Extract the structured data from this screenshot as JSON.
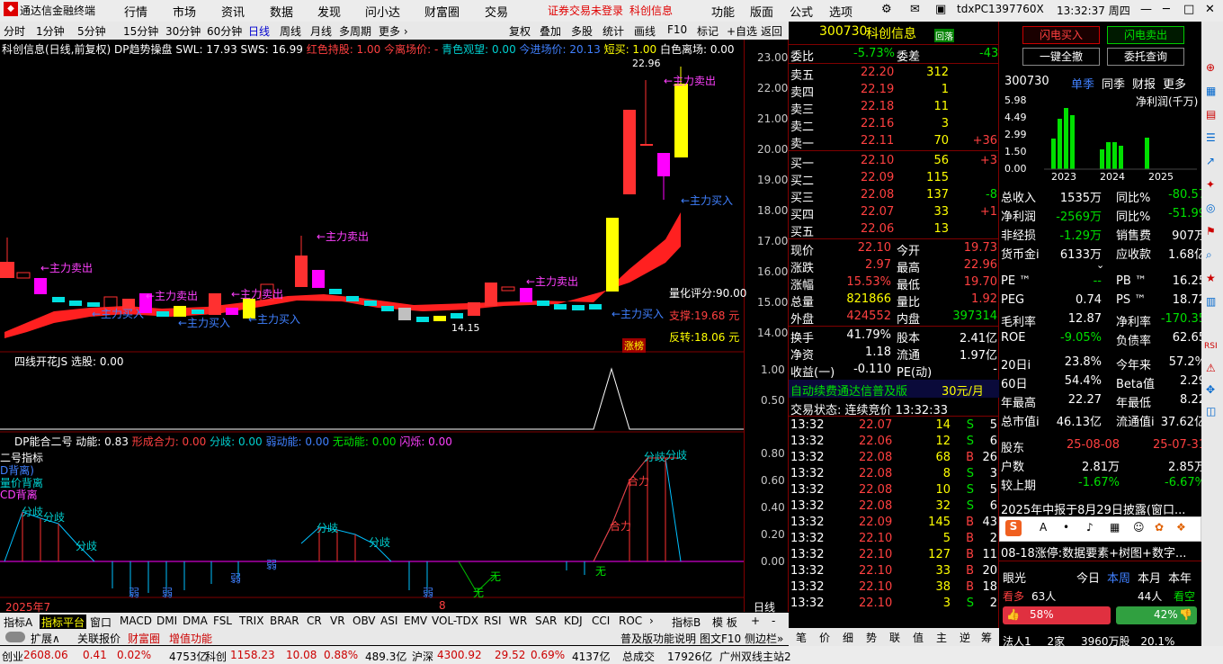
{
  "menubar": {
    "logo": "通达信金融终端",
    "items": [
      "行情",
      "市场",
      "资讯",
      "数据",
      "发现",
      "问小达",
      "财富圈",
      "交易"
    ],
    "warn": "证券交易未登录",
    "stock": "科创信息",
    "right": [
      "功能",
      "版面",
      "公式",
      "选项"
    ],
    "user": "tdxPC1397760X",
    "time": "13:32:37 周四"
  },
  "periods": [
    "分时",
    "1分钟",
    "5分钟",
    "15分钟",
    "30分钟",
    "60分钟",
    "日线",
    "周线",
    "月线",
    "多周期",
    "更多 ›"
  ],
  "tools": [
    "复权",
    "叠加",
    "多股",
    "统计",
    "画线",
    "F10",
    "标记",
    "+自选",
    "返回"
  ],
  "main_title": {
    "name": "科创信息(日线,前复权)",
    "indicator": "DP趋势操盘",
    "swl": "SWL: 17.93",
    "sws": "SWS: 16.99",
    "hold": "红色持股: 1.00",
    "leave": "今离场价: -",
    "observe": "青色观望: 0.00",
    "enter": "今进场价: 20.13",
    "short": "短买: 1.00",
    "white": "白色离场: 0.00"
  },
  "price_axis": [
    "23.00",
    "22.00",
    "21.00",
    "20.00",
    "19.00",
    "18.00",
    "17.00",
    "16.00",
    "15.00",
    "14.00"
  ],
  "annotations": {
    "high": "22.96",
    "low": "14.15",
    "main_sell": "←主力卖出",
    "main_buy": "←主力买入",
    "score": "量化评分:90.00",
    "support": "支撑:19.68 元",
    "reverse": "反转:18.06 元",
    "zt": "涨榜"
  },
  "panel2": {
    "title": "四线开花JS 选股: 0.00",
    "axis": [
      "1.00",
      "0.50"
    ]
  },
  "panel3": {
    "title": "DP能合二号 动能: 0.83",
    "xing": "形成合力: 0.00",
    "fen": "分歧: 0.00",
    "ruo": "弱动能: 0.00",
    "wu": "无动能: 0.00",
    "shan": "闪烁: 0.00",
    "axis": [
      "0.80",
      "0.60",
      "0.40",
      "0.20",
      "0.00"
    ],
    "legend": [
      "二号指标",
      "D背离)",
      "量价背离",
      "CD背离"
    ],
    "fenqi": "分歧",
    "heli": "合力",
    "wu_lbl": "无",
    "ruo_lbl": "弱"
  },
  "dates": {
    "d1": "2025年7",
    "d2": "8",
    "period": "日线"
  },
  "bottom_tabs": [
    "指标A",
    "指标平台",
    "窗口",
    "MACD",
    "DMI",
    "DMA",
    "FSL",
    "TRIX",
    "BRAR",
    "CR",
    "VR",
    "OBV",
    "ASI",
    "EMV",
    "VOL-TDX",
    "RSI",
    "WR",
    "SAR",
    "KDJ",
    "CCI",
    "ROC",
    "›",
    "指标B",
    "模 板",
    "+",
    "-"
  ],
  "sub_tabs": [
    "扩展∧",
    "关联报价",
    "财富圈",
    "增值功能",
    "普及版功能说明",
    "图文F10",
    "侧边栏»"
  ],
  "quote": {
    "code": "300730",
    "name": "科创信息",
    "tag": "回落",
    "weibi_l": "委比",
    "weibi": "-5.73%",
    "weicha_l": "委差",
    "weicha": "-43",
    "sells": [
      {
        "l": "卖五",
        "p": "22.20",
        "v": "312",
        "c": ""
      },
      {
        "l": "卖四",
        "p": "22.19",
        "v": "1",
        "c": ""
      },
      {
        "l": "卖三",
        "p": "22.18",
        "v": "11",
        "c": ""
      },
      {
        "l": "卖二",
        "p": "22.16",
        "v": "3",
        "c": ""
      },
      {
        "l": "卖一",
        "p": "22.11",
        "v": "70",
        "c": "+36"
      }
    ],
    "buys": [
      {
        "l": "买一",
        "p": "22.10",
        "v": "56",
        "c": "+3"
      },
      {
        "l": "买二",
        "p": "22.09",
        "v": "115",
        "c": ""
      },
      {
        "l": "买三",
        "p": "22.08",
        "v": "137",
        "c": "-8"
      },
      {
        "l": "买四",
        "p": "22.07",
        "v": "33",
        "c": "+1"
      },
      {
        "l": "买五",
        "p": "22.06",
        "v": "13",
        "c": ""
      }
    ],
    "stats": [
      [
        "现价",
        "22.10",
        "今开",
        "19.73"
      ],
      [
        "涨跌",
        "2.97",
        "最高",
        "22.96"
      ],
      [
        "涨幅",
        "15.53%",
        "最低",
        "19.70"
      ],
      [
        "总量",
        "821866",
        "量比",
        "1.92"
      ],
      [
        "外盘",
        "424552",
        "内盘",
        "397314"
      ]
    ],
    "stats2": [
      [
        "换手",
        "41.79%",
        "股本",
        "2.41亿"
      ],
      [
        "净资",
        "1.18",
        "流通",
        "1.97亿"
      ],
      [
        "收益(一)",
        "-0.110",
        "PE(动)",
        "-"
      ]
    ],
    "ad": "自动续费通达信普及版",
    "ad_price": "30元/月",
    "state": "交易状态: 连续竞价 13:32:33",
    "ticks": [
      [
        "13:32",
        "22.07",
        "14",
        "S",
        "5"
      ],
      [
        "13:32",
        "22.06",
        "12",
        "S",
        "6"
      ],
      [
        "13:32",
        "22.08",
        "68",
        "B",
        "26"
      ],
      [
        "13:32",
        "22.08",
        "8",
        "S",
        "3"
      ],
      [
        "13:32",
        "22.08",
        "10",
        "S",
        "5"
      ],
      [
        "13:32",
        "22.08",
        "32",
        "S",
        "6"
      ],
      [
        "13:32",
        "22.09",
        "145",
        "B",
        "43"
      ],
      [
        "13:32",
        "22.10",
        "5",
        "B",
        "2"
      ],
      [
        "13:32",
        "22.10",
        "127",
        "B",
        "11"
      ],
      [
        "13:32",
        "22.10",
        "33",
        "B",
        "20"
      ],
      [
        "13:32",
        "22.10",
        "38",
        "B",
        "18"
      ],
      [
        "13:32",
        "22.10",
        "3",
        "S",
        "2"
      ]
    ],
    "bottom": [
      "笔",
      "价",
      "细",
      "势",
      "联",
      "值",
      "主",
      "逆",
      "筹"
    ]
  },
  "info": {
    "btn_buy": "闪电买入",
    "btn_sell": "闪电卖出",
    "btn_clear": "一键全撤",
    "btn_query": "委托查询",
    "code": "300730",
    "tabs": [
      "单季",
      "同季",
      "财报",
      "更多"
    ],
    "profit_lbl": "净利润(千万)",
    "y_axis": [
      "5.98",
      "4.49",
      "2.99",
      "1.50",
      "0.00"
    ],
    "years": [
      "2023",
      "2024",
      "2025"
    ],
    "fin": [
      [
        "总收入",
        "1535万",
        "同比%",
        "-80.57"
      ],
      [
        "净利润",
        "-2569万",
        "同比%",
        "-51.99"
      ],
      [
        "非经损",
        "-1.29万",
        "销售费",
        "907万"
      ],
      [
        "货币金i",
        "6133万",
        "应收款",
        "1.68亿"
      ]
    ],
    "fin2": [
      [
        "PE ™",
        "--",
        "PB ™",
        "16.25"
      ],
      [
        "PEG",
        "0.74",
        "PS ™",
        "18.72"
      ],
      [
        "毛利率",
        "12.87",
        "净利率",
        "-170.35"
      ],
      [
        "ROE",
        "-9.05%",
        "负债率",
        "62.65"
      ]
    ],
    "fin3": [
      [
        "20日i",
        "23.8%",
        "今年来",
        "57.2%"
      ],
      [
        "60日",
        "54.4%",
        "Beta值",
        "2.29"
      ],
      [
        "年最高",
        "22.27",
        "年最低",
        "8.22"
      ],
      [
        "总市值i",
        "46.13亿",
        "流通值i",
        "37.62亿"
      ]
    ],
    "holders": [
      [
        "股东",
        "25-08-08",
        "25-07-31"
      ],
      [
        "户数",
        "2.81万",
        "2.85万"
      ],
      [
        "较上期",
        "-1.67%",
        "-6.67%"
      ]
    ],
    "report": "2025年中报于8月29日披露(窗口...",
    "news": "08-18涨停:数据要素+树图+数字...",
    "eye": "眼光",
    "eye_tabs": [
      "今日",
      "本周",
      "本月",
      "本年"
    ],
    "bull": "看多",
    "bull_n": "63人",
    "bear_n": "44人",
    "bear": "看空",
    "bull_pct": "58%",
    "bear_pct": "42%",
    "foot": "法人1",
    "foot2": "2家",
    "foot3": "3960万股",
    "foot4": "20.1%"
  },
  "status": {
    "a": "创业",
    "av": "2608.06",
    "ac": "0.41",
    "ap": "0.02%",
    "aa": "4753亿",
    "b": "科创",
    "bv": "1158.23",
    "bc": "10.08",
    "bp": "0.88%",
    "ba": "489.3亿",
    "c": "沪深",
    "cv": "4300.92",
    "cc": "29.52",
    "cp": "0.69%",
    "ca": "4137亿",
    "d": "总成交",
    "dv": "17926亿",
    "site": "广州双线主站2"
  },
  "colors": {
    "up": "#ff3030",
    "down": "#00e0e0",
    "yellow": "#ffff00",
    "magenta": "#ff00ff"
  }
}
